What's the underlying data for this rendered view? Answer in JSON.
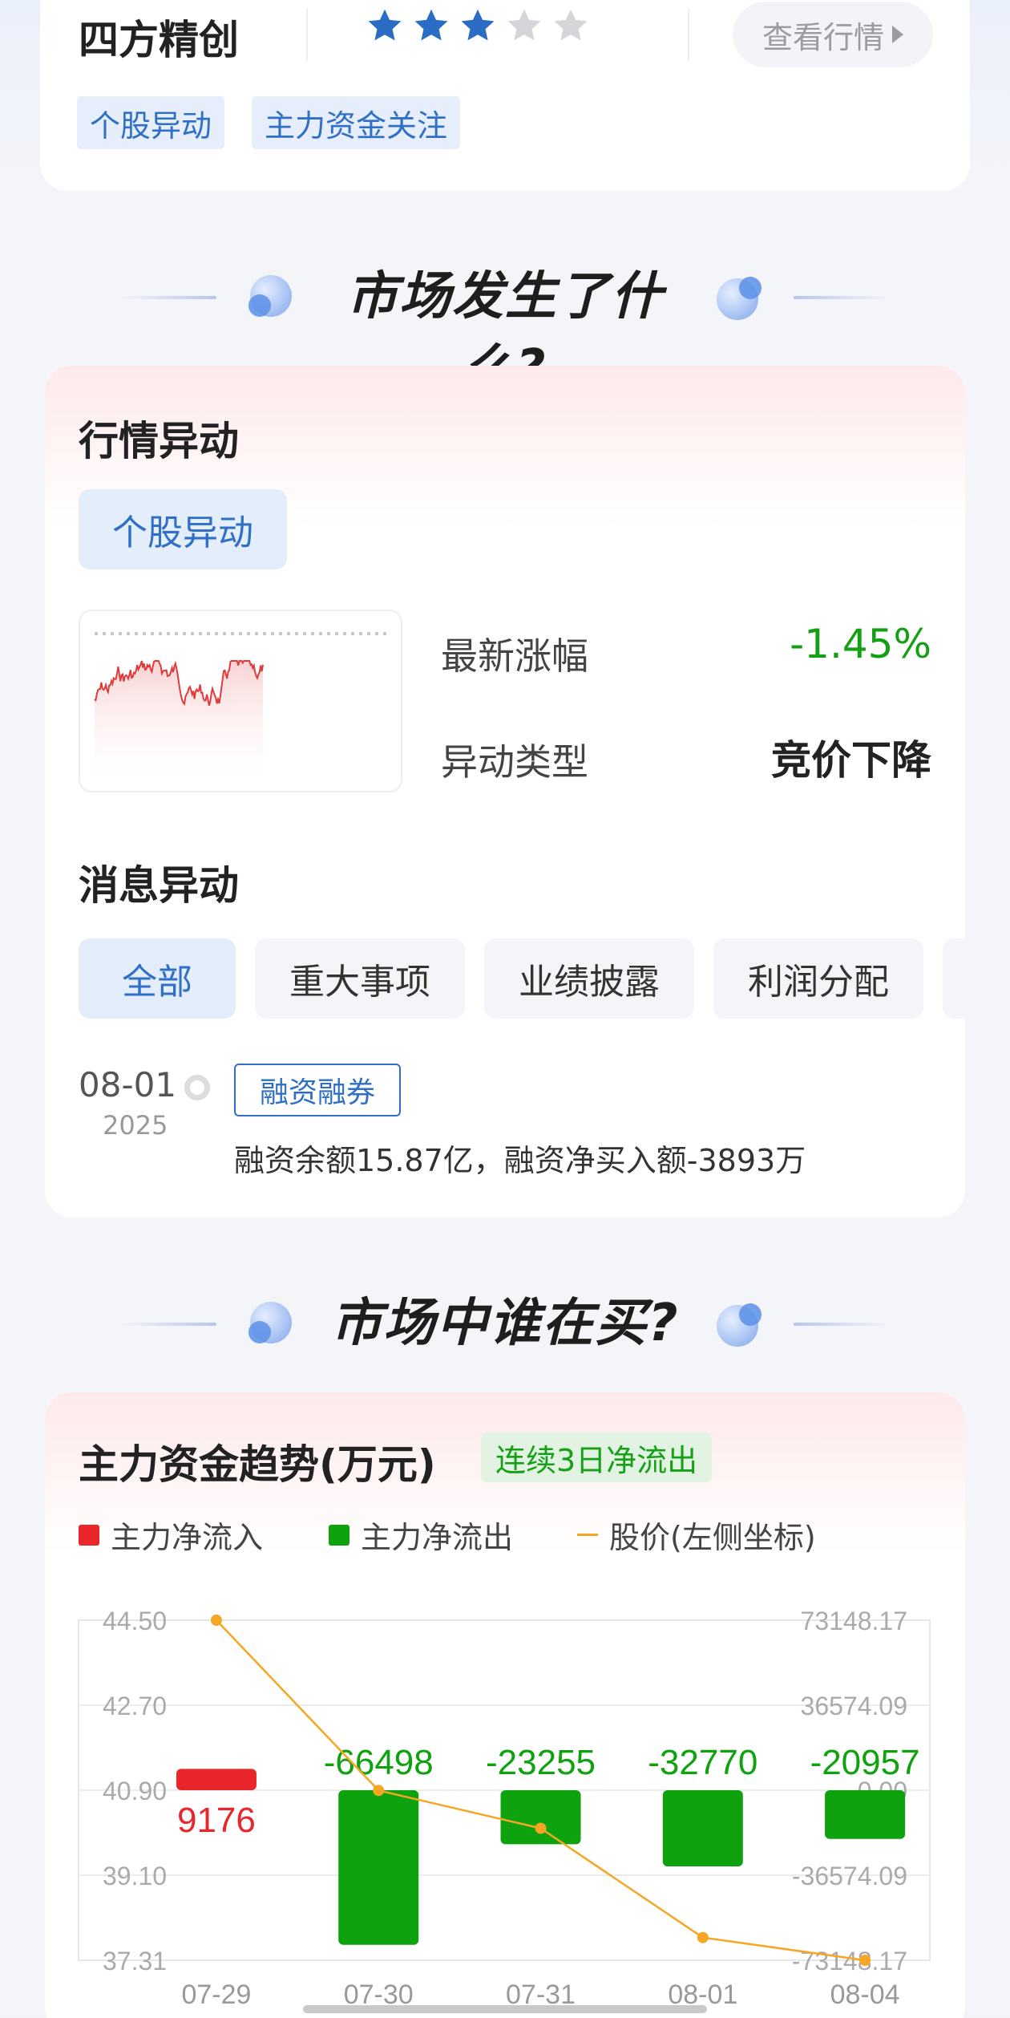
{
  "stock_header": {
    "name": "四方精创",
    "rating": 3,
    "rating_max": 5,
    "view_button": "查看行情",
    "tags": [
      "个股异动",
      "主力资金关注"
    ]
  },
  "sections": {
    "what_happened": "市场发生了什么?",
    "who_buying": "市场中谁在买?"
  },
  "market_anomaly": {
    "title": "行情异动",
    "chip": "个股异动",
    "latest_change_label": "最新涨幅",
    "latest_change_value": "-1.45%",
    "anomaly_type_label": "异动类型",
    "anomaly_type_value": "竞价下降"
  },
  "news_anomaly": {
    "title": "消息异动",
    "filters": [
      "全部",
      "重大事项",
      "业绩披露",
      "利润分配"
    ],
    "active_filter": "全部",
    "items": [
      {
        "date": "08-01",
        "year": "2025",
        "tag": "融资融券",
        "text": "融资余额15.87亿，融资净买入额-3893万"
      }
    ]
  },
  "capital_flow": {
    "title": "主力资金趋势(万元)",
    "badge": "连续3日净流出",
    "legend": {
      "inflow": "主力净流入",
      "outflow": "主力净流出",
      "price": "股价(左侧坐标)"
    }
  },
  "colors": {
    "accent_blue": "#2f6fc5",
    "up_red": "#e8262b",
    "down_green": "#0ea20e",
    "price_line": "#f5a623"
  },
  "chart_data": {
    "type": "bar",
    "categories": [
      "07-29",
      "07-30",
      "07-31",
      "08-01",
      "08-04"
    ],
    "series": [
      {
        "name": "主力净流入/净流出",
        "values": [
          9176,
          -66498,
          -23255,
          -32770,
          -20957
        ]
      },
      {
        "name": "股价(左侧坐标)",
        "type": "line",
        "values": [
          44.5,
          40.9,
          40.1,
          37.79,
          37.31
        ]
      }
    ],
    "left_axis": {
      "ticks": [
        "44.50",
        "42.70",
        "40.90",
        "39.10",
        "37.31"
      ],
      "ylim": [
        37.31,
        44.5
      ]
    },
    "right_axis": {
      "ticks": [
        "73148.17",
        "36574.09",
        "0.00",
        "-36574.09",
        "-73148.17"
      ],
      "ylim": [
        -73148.17,
        73148.17
      ]
    },
    "data_labels": [
      "9176",
      "-66498",
      "-23255",
      "-32770",
      "-20957"
    ]
  }
}
